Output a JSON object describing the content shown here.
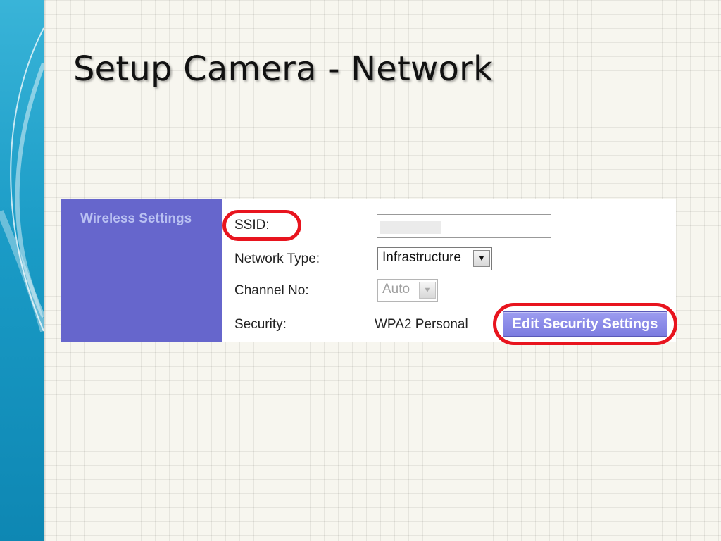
{
  "slide": {
    "title": "Setup Camera - Network"
  },
  "panel": {
    "section_label": "Wireless Settings",
    "fields": {
      "ssid": {
        "label": "SSID:",
        "value": ""
      },
      "network_type": {
        "label": "Network Type:",
        "value": "Infrastructure"
      },
      "channel": {
        "label": "Channel No:",
        "value": "Auto"
      },
      "security": {
        "label": "Security:",
        "value": "WPA2 Personal"
      }
    },
    "edit_button_label": "Edit Security Settings"
  },
  "colors": {
    "panel_side": "#6666cc",
    "highlight_ring": "#e8141e",
    "button": "#8888e6",
    "left_band": "#1a9bc6"
  }
}
